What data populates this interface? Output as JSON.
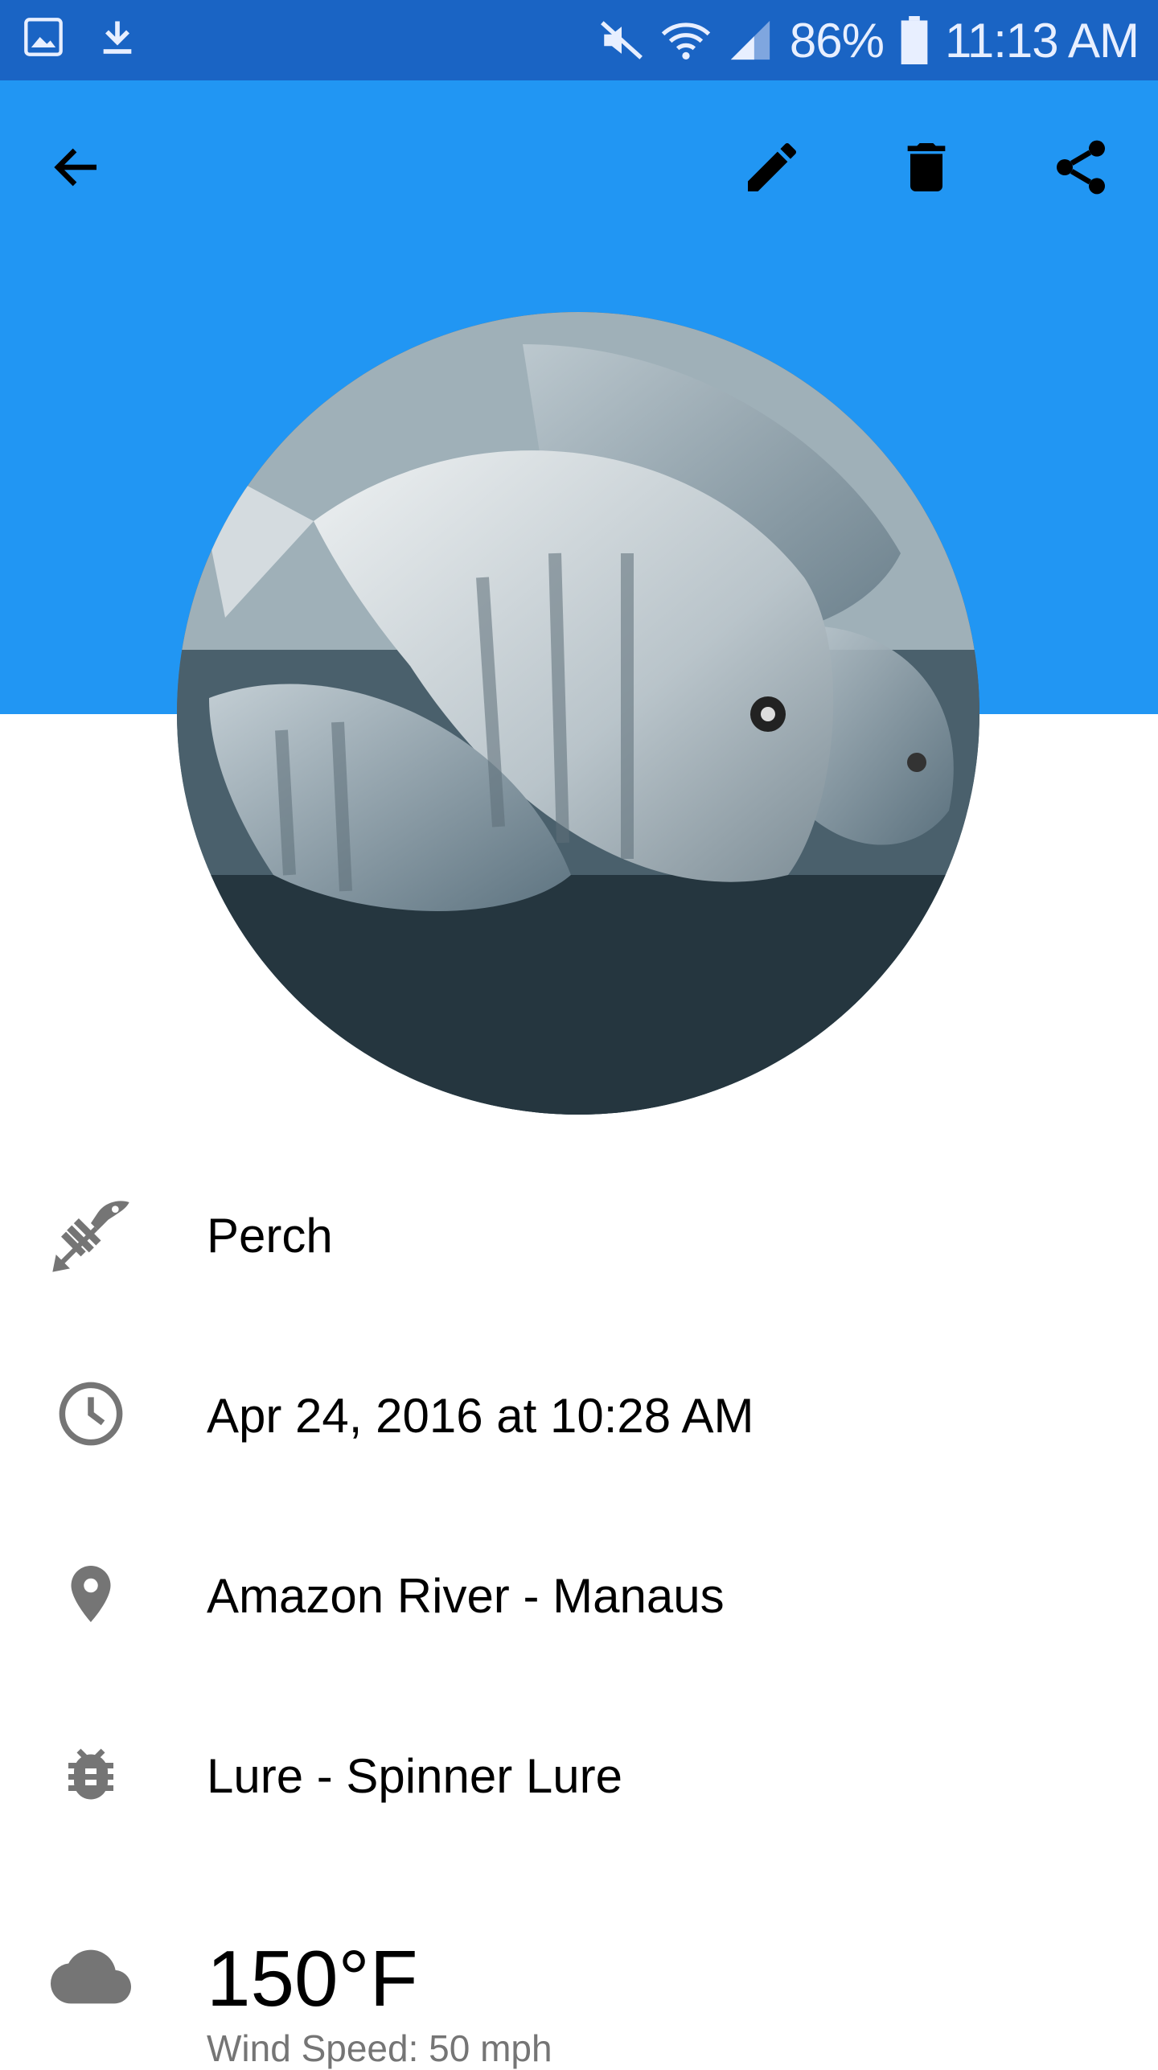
{
  "status_bar": {
    "battery": "86%",
    "time": "11:13 AM",
    "icons": [
      "image-icon",
      "download-icon",
      "mute-icon",
      "wifi-icon",
      "signal-icon",
      "battery-icon"
    ]
  },
  "toolbar": {
    "icons": [
      "back-arrow-icon",
      "edit-pencil-icon",
      "delete-trash-icon",
      "share-icon"
    ]
  },
  "colors": {
    "status_bar": "#1a64c4",
    "header": "#2196f3",
    "icon_gray": "#757575"
  },
  "details": {
    "species": "Perch",
    "date_time": "Apr 24, 2016 at 10:28 AM",
    "location": "Amazon River - Manaus",
    "bait": "Lure - Spinner Lure",
    "temperature": "150°F",
    "wind": "Wind Speed: 50 mph"
  }
}
